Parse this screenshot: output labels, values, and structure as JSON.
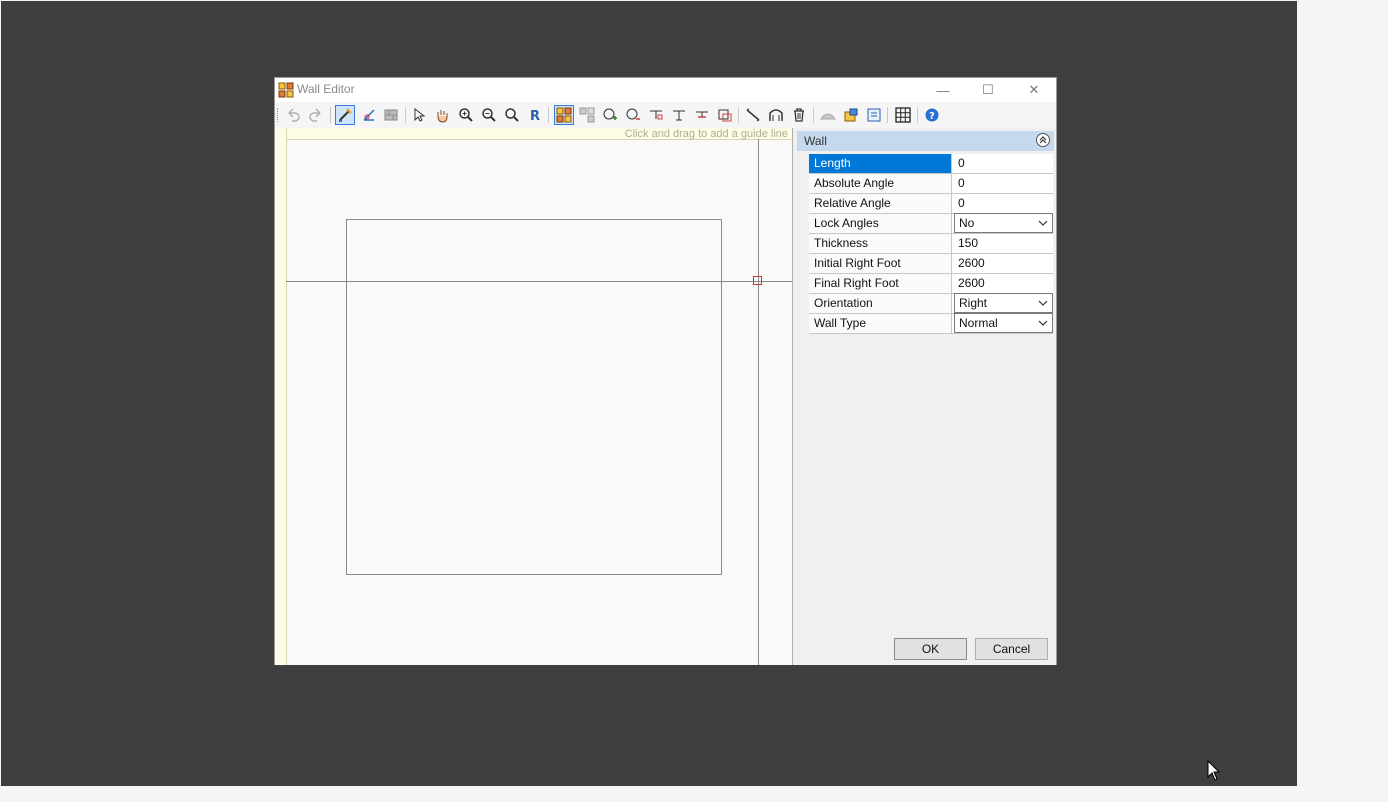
{
  "window": {
    "title": "Wall Editor",
    "controls": {
      "minimize": "—",
      "maximize": "☐",
      "close": "✕"
    }
  },
  "canvas": {
    "ruler_hint": "Click and drag to add a guide line"
  },
  "panel": {
    "group_title": "Wall",
    "properties": [
      {
        "name": "Length",
        "value": "0",
        "selected": true,
        "dropdown": false
      },
      {
        "name": "Absolute Angle",
        "value": "0",
        "dropdown": false
      },
      {
        "name": "Relative Angle",
        "value": "0",
        "dropdown": false
      },
      {
        "name": "Lock Angles",
        "value": "No",
        "dropdown": true
      },
      {
        "name": "Thickness",
        "value": "150",
        "dropdown": false
      },
      {
        "name": "Initial Right Foot",
        "value": "2600",
        "dropdown": false
      },
      {
        "name": "Final Right Foot",
        "value": "2600",
        "dropdown": false
      },
      {
        "name": "Orientation",
        "value": "Right",
        "dropdown": true
      },
      {
        "name": "Wall Type",
        "value": "Normal",
        "dropdown": true
      }
    ]
  },
  "buttons": {
    "ok": "OK",
    "cancel": "Cancel"
  },
  "colors": {
    "selection": "#0078d7",
    "group_header": "#c5d8ee",
    "backdrop": "#3e3e3e",
    "node": "#c0392b"
  }
}
